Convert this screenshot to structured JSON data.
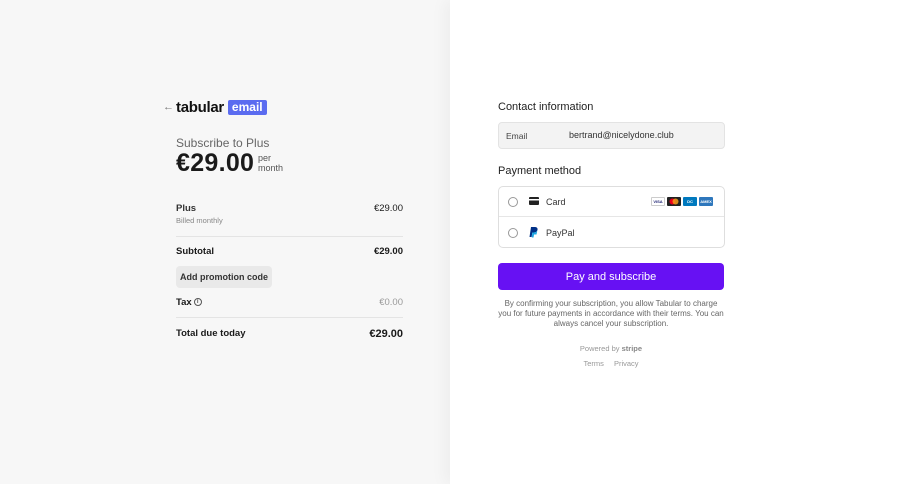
{
  "header": {
    "back_arrow": "←",
    "brand_name": "tabular",
    "brand_badge": "email"
  },
  "summary": {
    "subscribe_label": "Subscribe to Plus",
    "price": "€29.00",
    "period_line1": "per",
    "period_line2": "month",
    "item_name": "Plus",
    "item_price": "€29.00",
    "item_billing": "Billed monthly",
    "subtotal_label": "Subtotal",
    "subtotal_value": "€29.00",
    "promo_button": "Add promotion code",
    "tax_label": "Tax",
    "tax_info_glyph": "i",
    "tax_value": "€0.00",
    "total_label": "Total due today",
    "total_value": "€29.00"
  },
  "checkout": {
    "contact_title": "Contact information",
    "email_label": "Email",
    "email_value": "bertrand@nicelydone.club",
    "payment_title": "Payment method",
    "methods": [
      {
        "label": "Card",
        "icon": "credit-card-icon"
      },
      {
        "label": "PayPal",
        "icon": "paypal-icon"
      }
    ],
    "card_brands": [
      {
        "name": "VISA",
        "color": "#ffffff",
        "text": "#1a1f71"
      },
      {
        "name": "MC",
        "color": "#eb001b",
        "text": "#ffffff"
      },
      {
        "name": "DC",
        "color": "#0079be",
        "text": "#ffffff"
      },
      {
        "name": "AMEX",
        "color": "#2e77bc",
        "text": "#ffffff"
      }
    ],
    "pay_button": "Pay and subscribe",
    "pay_button_color": "#6711f3",
    "terms_text": "By confirming your subscription, you allow Tabular to charge you for future payments in accordance with their terms. You can always cancel your subscription.",
    "powered_by": "Powered by",
    "powered_brand": "stripe",
    "footer_links": [
      "Terms",
      "Privacy"
    ]
  }
}
